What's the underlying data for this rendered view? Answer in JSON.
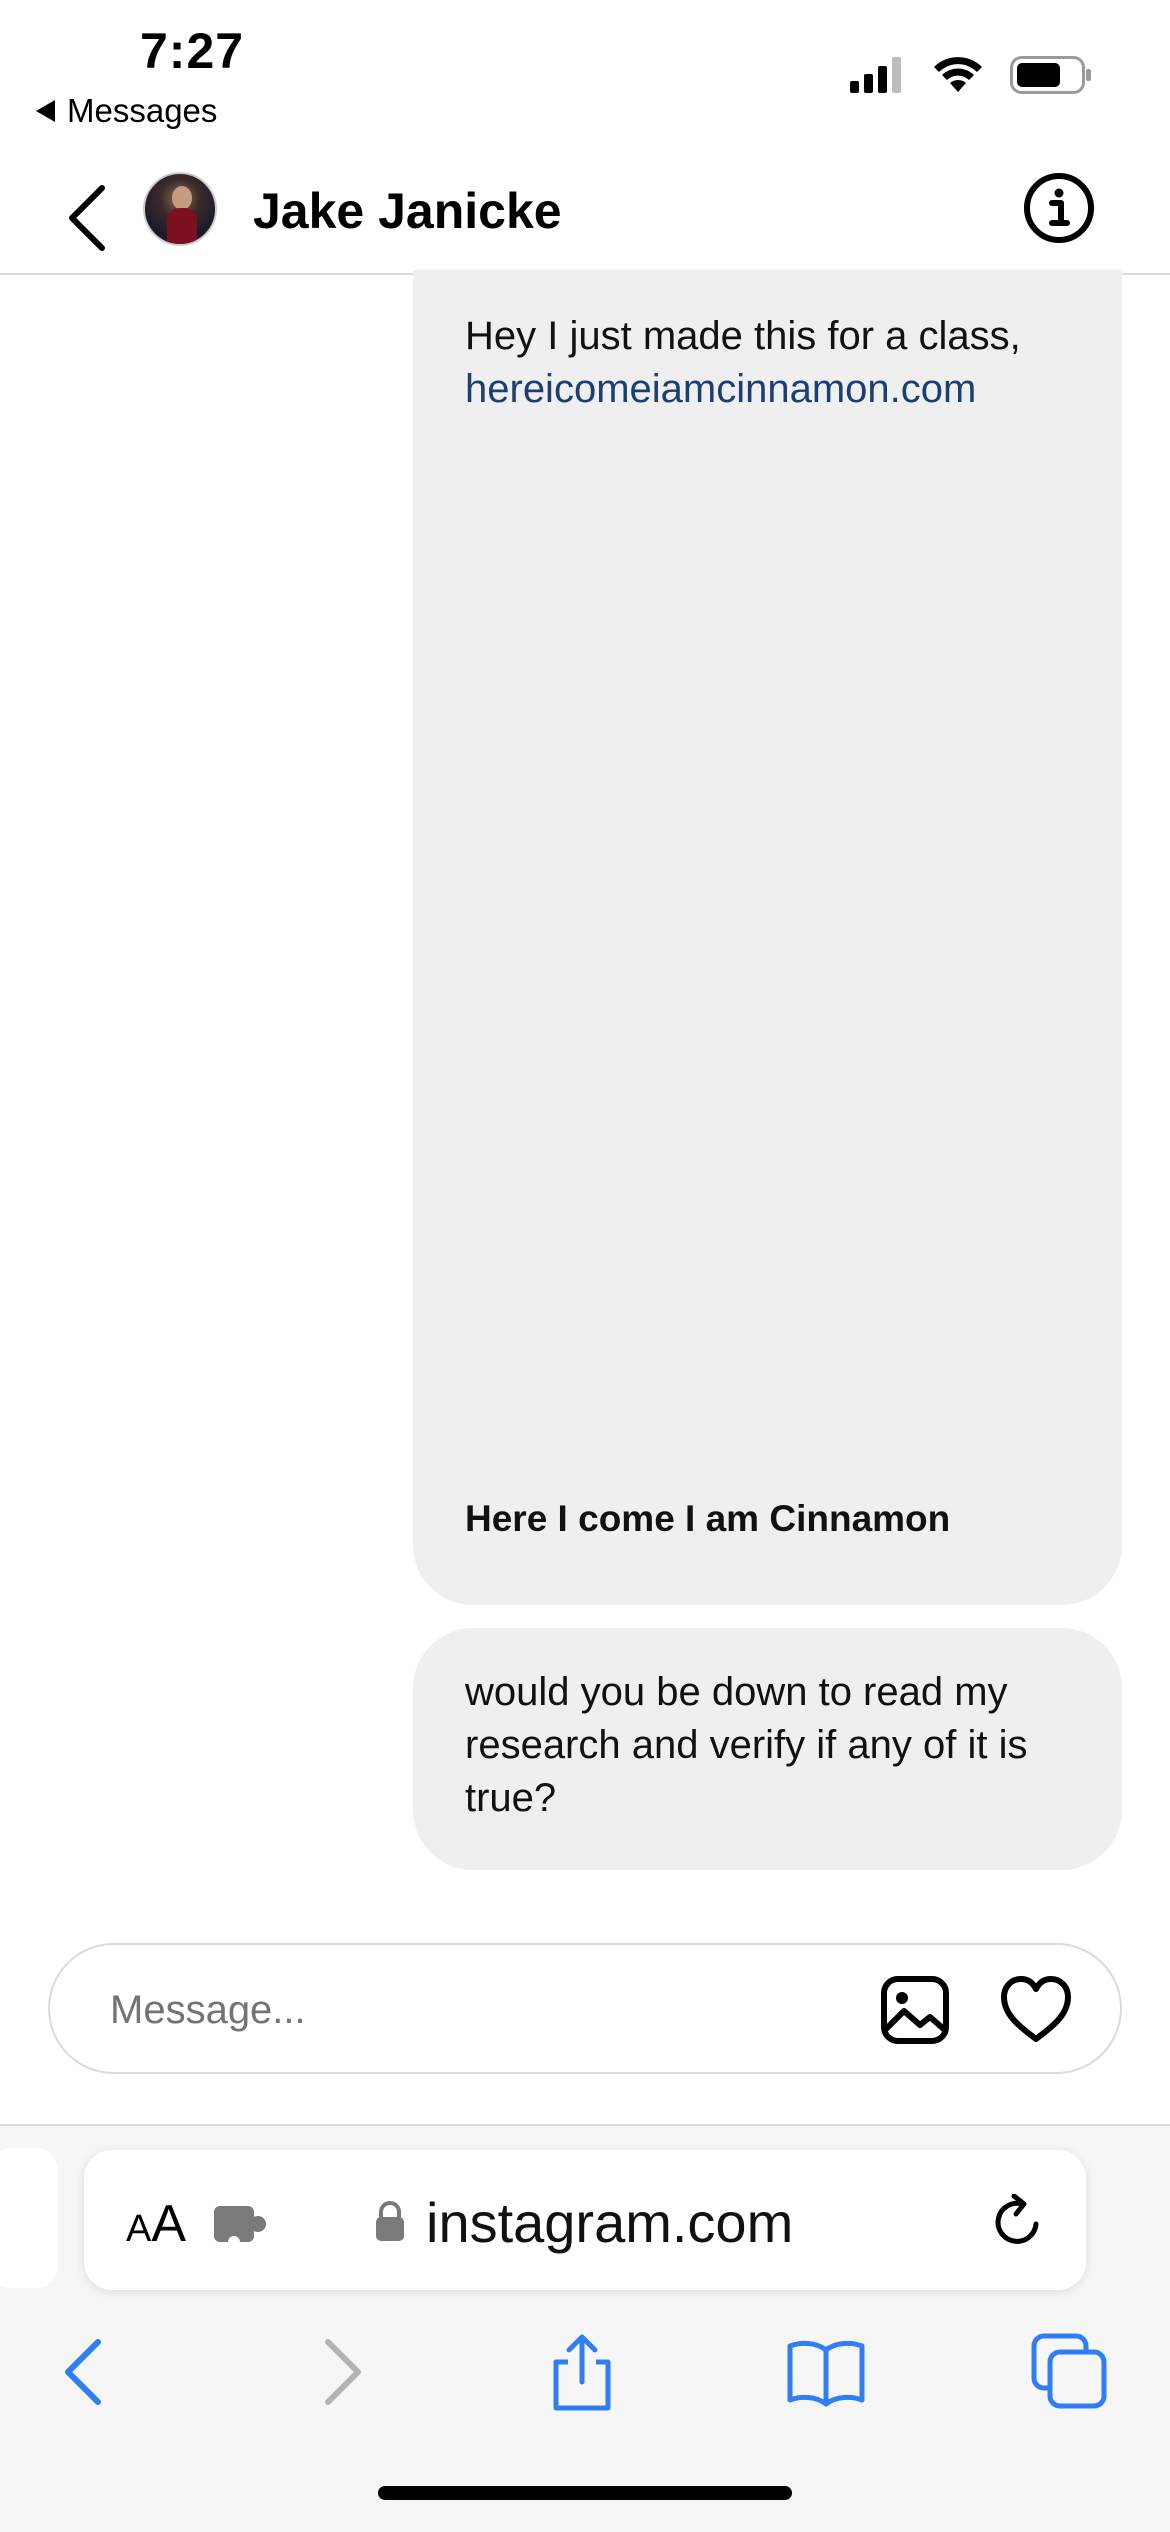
{
  "status_bar": {
    "time": "7:27",
    "back_label": "Messages"
  },
  "header": {
    "contact_name": "Jake Janicke"
  },
  "messages": [
    {
      "text": "Hey I just made this for a class,",
      "link": "hereicomeiamcinnamon.com",
      "preview_title": "Here I come I am Cinnamon"
    },
    {
      "text": "would you be down to read my research and verify if any of it is true?"
    }
  ],
  "composer": {
    "placeholder": "Message..."
  },
  "browser": {
    "text_size_label": "AA",
    "url": "instagram.com"
  },
  "colors": {
    "bubble_bg": "#efefef",
    "link": "#1c3f72",
    "safari_blue": "#2f7ef6"
  }
}
